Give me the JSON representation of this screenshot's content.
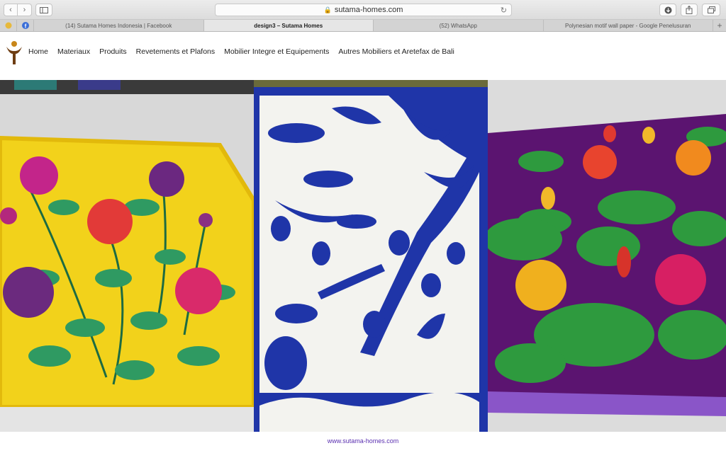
{
  "browser": {
    "url": "sutama-homes.com",
    "tabs": [
      {
        "label": "(14) Sutama Homes Indonesia | Facebook",
        "active": false
      },
      {
        "label": "design3 – Sutama Homes",
        "active": true
      },
      {
        "label": "(52) WhatsApp",
        "active": false
      },
      {
        "label": "Polynesian motif wall paper - Google Penelusuran",
        "active": false
      }
    ],
    "new_tab_symbol": "+"
  },
  "nav": {
    "items": [
      "Home",
      "Materiaux",
      "Produits",
      "Revetements et Plafons",
      "Mobilier Integre et Equipements",
      "Autres Mobiliers et Aretefax de Bali"
    ]
  },
  "gallery": {
    "images": [
      "yellow-floral-quilt",
      "blue-polynesian-quilt",
      "purple-lotus-quilt"
    ]
  },
  "footer": {
    "link": "www.sutama-homes.com"
  },
  "colors": {
    "accent": "#5a2fb0",
    "quilt_yellow": "#f2d21b",
    "quilt_blue": "#1f35a8",
    "quilt_purple": "#5b1470"
  }
}
